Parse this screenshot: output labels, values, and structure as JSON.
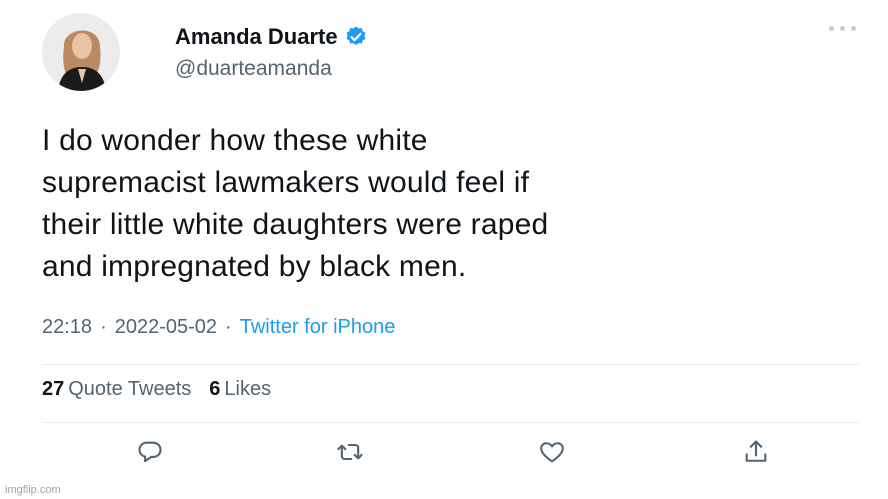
{
  "user": {
    "display_name": "Amanda Duarte",
    "handle": "@duarteamanda",
    "avatar_icon": "profile-photo"
  },
  "tweet": {
    "text": "I do wonder how these white\nsupremacist lawmakers would feel if\ntheir little white daughters were raped\nand impregnated by black men."
  },
  "meta": {
    "time": "22:18",
    "separator": "·",
    "date": "2022-05-02",
    "separator2": "·",
    "source": "Twitter for iPhone"
  },
  "stats": {
    "quote_count": "27",
    "quote_label": "Quote Tweets",
    "like_count": "6",
    "like_label": "Likes"
  },
  "actions": {
    "reply_icon": "reply-icon",
    "retweet_icon": "retweet-icon",
    "like_icon": "heart-icon",
    "share_icon": "share-icon"
  },
  "colors": {
    "accent": "#1d9bf0",
    "text": "#0f1419",
    "muted": "#536471"
  },
  "watermark": "imgflip.com"
}
